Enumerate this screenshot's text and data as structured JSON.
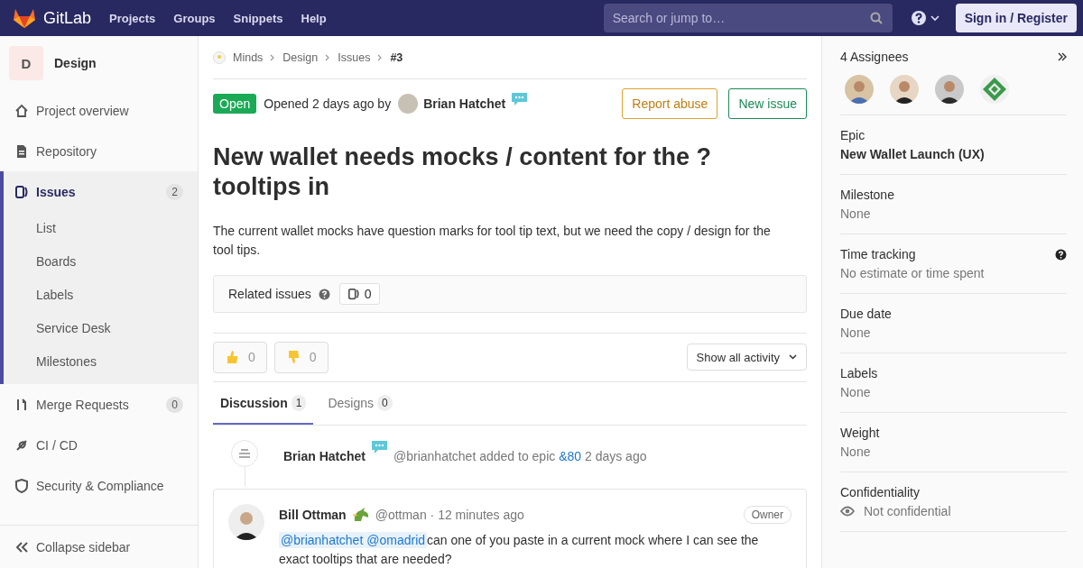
{
  "topbar": {
    "brand": "GitLab",
    "nav": [
      "Projects",
      "Groups",
      "Snippets",
      "Help"
    ],
    "search": {
      "placeholder": "Search or jump to…"
    },
    "sign_in": "Sign in / Register"
  },
  "sidebar": {
    "project": {
      "initial": "D",
      "name": "Design"
    },
    "items": [
      {
        "label": "Project overview",
        "selected": false
      },
      {
        "label": "Repository",
        "selected": false
      },
      {
        "label": "Issues",
        "selected": true,
        "count": "2",
        "children": [
          {
            "label": "List"
          },
          {
            "label": "Boards"
          },
          {
            "label": "Labels"
          },
          {
            "label": "Service Desk"
          },
          {
            "label": "Milestones"
          }
        ]
      },
      {
        "label": "Merge Requests",
        "selected": false,
        "count": "0"
      },
      {
        "label": "CI / CD",
        "selected": false
      },
      {
        "label": "Security & Compliance",
        "selected": false
      }
    ],
    "collapse": "Collapse sidebar"
  },
  "breadcrumb": [
    "Minds",
    "Design",
    "Issues",
    "#3"
  ],
  "issue": {
    "status": "Open",
    "opened": "Opened 2 days ago by",
    "author": "Brian Hatchet",
    "report": "Report abuse",
    "new": "New issue",
    "title": "New wallet needs mocks / content for the ? tooltips in",
    "description": "The current wallet mocks have question marks for tool tip text, but we need the copy / design for the tool tips.",
    "related": {
      "label": "Related issues",
      "count": "0"
    },
    "reactions": [
      {
        "kind": "up",
        "count": "0"
      },
      {
        "kind": "down",
        "count": "0"
      }
    ],
    "filter": "Show all activity",
    "tabs": [
      {
        "label": "Discussion",
        "count": "1",
        "selected": true
      },
      {
        "label": "Designs",
        "count": "0",
        "selected": false
      }
    ],
    "note": {
      "author": "Brian Hatchet",
      "before": "@brianhatchet added to epic",
      "link": "&80",
      "after": "2 days ago"
    },
    "comment": {
      "author": "Bill Ottman",
      "handle": "@ottman · 12 minutes ago",
      "role": "Owner",
      "mentions": [
        "@brianhatchet",
        "@omadrid"
      ],
      "text": "can one of you paste in a current mock where I can see the exact tooltips that are needed?"
    }
  },
  "right": {
    "assignees": "4 Assignees",
    "fields": [
      {
        "label": "Epic",
        "value": "New Wallet Launch (UX)",
        "kind": "bold"
      },
      {
        "label": "Milestone",
        "value": "None",
        "kind": "plain"
      },
      {
        "label": "Time tracking",
        "value": "No estimate or time spent",
        "kind": "help"
      },
      {
        "label": "Due date",
        "value": "None",
        "kind": "plain"
      },
      {
        "label": "Labels",
        "value": "None",
        "kind": "plain"
      },
      {
        "label": "Weight",
        "value": "None",
        "kind": "plain"
      },
      {
        "label": "Confidentiality",
        "value": "Not confidential",
        "kind": "eye"
      }
    ]
  }
}
